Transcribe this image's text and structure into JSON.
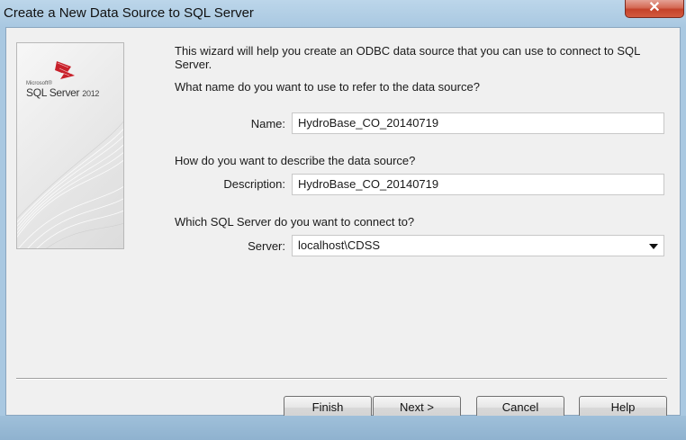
{
  "window": {
    "title": "Create a New Data Source to SQL Server",
    "close_symbol": "✕"
  },
  "side_image": {
    "logo_small": "Microsoft®",
    "logo_main": "SQL Server",
    "logo_year": "2012"
  },
  "wizard": {
    "intro": "This wizard will help you create an ODBC data source that you can use to connect to SQL Server.",
    "name_question": "What name do you want to use to refer to the data source?",
    "name_label": "Name:",
    "name_value": "HydroBase_CO_20140719",
    "description_question": "How do you want to describe the data source?",
    "description_label": "Description:",
    "description_value": "HydroBase_CO_20140719",
    "server_question": "Which SQL Server do you want to connect to?",
    "server_label": "Server:",
    "server_value": "localhost\\CDSS"
  },
  "buttons": {
    "finish": "Finish",
    "next": "Next >",
    "cancel": "Cancel",
    "help": "Help"
  },
  "icons": {
    "close": "close-icon",
    "dropdown": "chevron-down-icon",
    "logo": "sql-server-logo-icon"
  }
}
